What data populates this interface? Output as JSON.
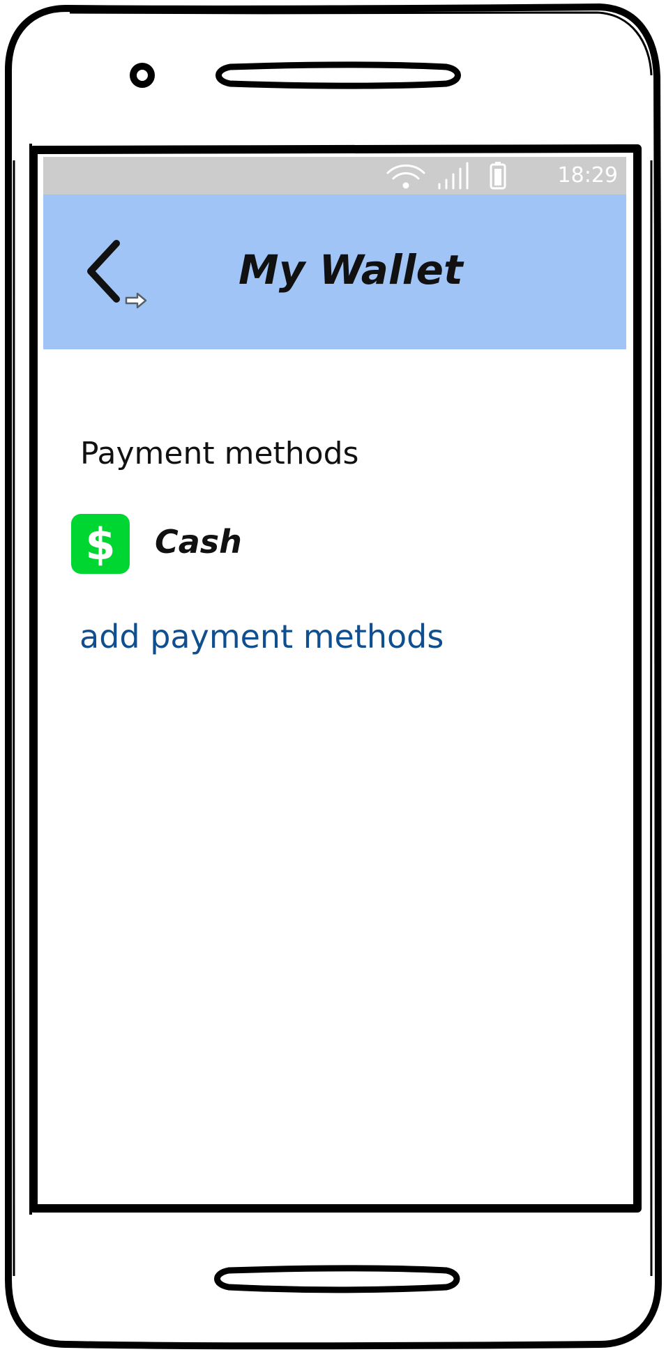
{
  "status_bar": {
    "time": "18:29",
    "icons": [
      "wifi-icon",
      "signal-icon",
      "battery-icon"
    ]
  },
  "app_bar": {
    "title": "My Wallet",
    "back_icon": "chevron-left-icon",
    "background": "#a1c4f6"
  },
  "payment_section": {
    "heading": "Payment methods",
    "methods": [
      {
        "label": "Cash",
        "icon": "cash-dollar-icon",
        "icon_color": "#00d632"
      }
    ],
    "add_link": "add payment methods",
    "link_color": "#0f4f8f"
  }
}
